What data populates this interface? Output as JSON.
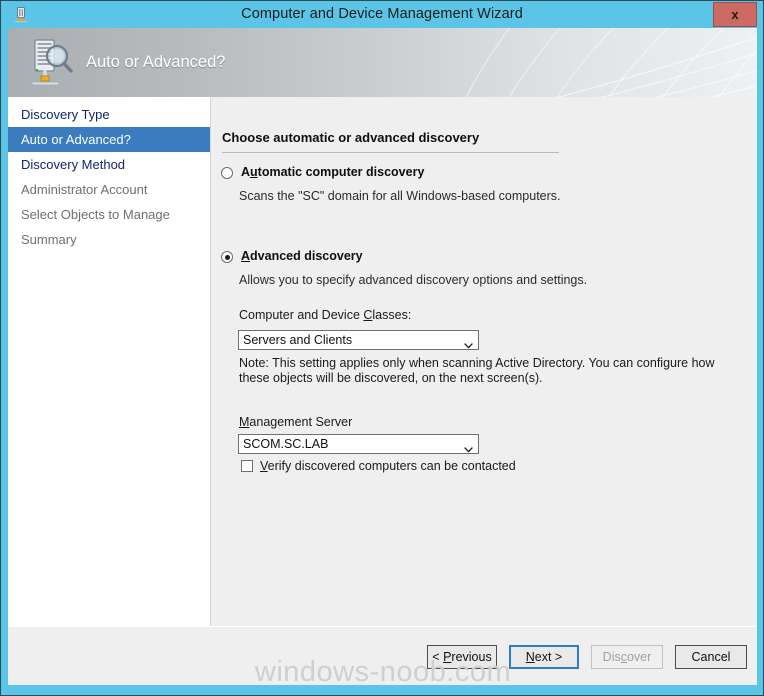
{
  "window": {
    "title": "Computer and Device Management Wizard",
    "titlebar_icon": "server-icon",
    "close_label": "x",
    "accent_blue": "#5bc5e8",
    "close_red": "#cd6a63"
  },
  "header": {
    "title": "Auto or Advanced?",
    "icon": "server-discovery-icon"
  },
  "sidebar": {
    "items": [
      {
        "label": "Discovery Type",
        "state": "enabled"
      },
      {
        "label": "Auto or Advanced?",
        "state": "active"
      },
      {
        "label": "Discovery Method",
        "state": "enabled"
      },
      {
        "label": "Administrator Account",
        "state": "disabled"
      },
      {
        "label": "Select Objects to Manage",
        "state": "disabled"
      },
      {
        "label": "Summary",
        "state": "disabled"
      }
    ],
    "active_background": "#3a7cbd"
  },
  "main": {
    "heading": "Choose automatic or advanced discovery",
    "automatic": {
      "label_pre": "A",
      "label_accel": "u",
      "label_post": "tomatic computer discovery",
      "selected": false,
      "description": "Scans the \"SC\" domain for all Windows-based computers."
    },
    "advanced": {
      "label_accel": "A",
      "label_post": "dvanced discovery",
      "selected": true,
      "description": "Allows you to specify advanced discovery options and settings.",
      "classes_label_pre": "Computer and Device ",
      "classes_label_accel": "C",
      "classes_label_post": "lasses:",
      "classes_value": "Servers and Clients",
      "classes_options": [
        "Servers and Clients"
      ],
      "note": "Note: This setting applies only when scanning Active Directory.  You can configure how these objects will be discovered, on the next screen(s)."
    },
    "management_server": {
      "label_accel": "M",
      "label_post": "anagement Server",
      "value": "SCOM.SC.LAB",
      "options": [
        "SCOM.SC.LAB"
      ]
    },
    "verify_checkbox": {
      "label_accel": "V",
      "label_post": "erify discovered computers can be contacted",
      "checked": false
    }
  },
  "footer": {
    "previous": {
      "pre": "< ",
      "accel": "P",
      "post": "revious",
      "disabled": false
    },
    "next": {
      "pre": "",
      "accel": "N",
      "post": "ext >",
      "disabled": false,
      "is_default": true
    },
    "discover": {
      "pre": "Dis",
      "accel": "c",
      "post": "over",
      "disabled": true
    },
    "cancel": {
      "pre": "Cancel",
      "accel": "",
      "post": "",
      "disabled": false
    }
  },
  "watermark": "windows-noob.com"
}
